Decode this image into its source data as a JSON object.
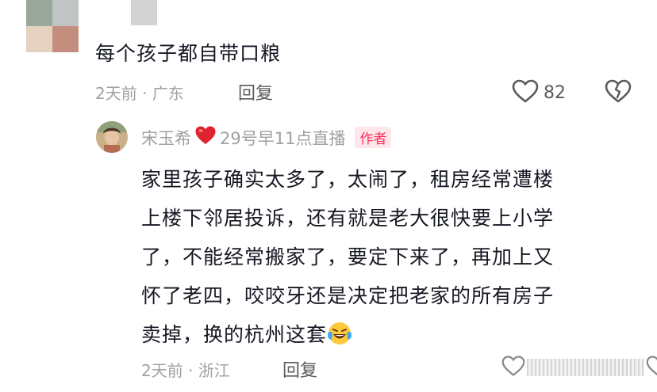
{
  "comment": {
    "text": "每个孩子都自带口粮",
    "time": "2天前",
    "separator": "·",
    "location": "广东",
    "reply_label": "回复",
    "like_count": "82"
  },
  "reply": {
    "author": "宋玉希",
    "author_suffix": "29号早11点直播",
    "badge": "作者",
    "lines": [
      "家里孩子确实太多了，太闹了，租房经常遭楼",
      "上楼下邻居投诉，还有就是老大很快要上小学",
      "了，不能经常搬家了，要定下来了，再加上又",
      "怀了老四，咬咬牙还是决定把老家的所有房子",
      "卖掉，换的杭州这套"
    ],
    "time": "2天前",
    "separator": "·",
    "location": "浙江",
    "reply_label": "回复"
  },
  "colors": {
    "accent_red": "#fe2c55",
    "meta_gray": "#a0a0a5",
    "text_dark": "#161823"
  },
  "icons": [
    "heart-icon",
    "dislike-heart-icon",
    "red-heart-emoji",
    "laughing-crying-emoji"
  ]
}
